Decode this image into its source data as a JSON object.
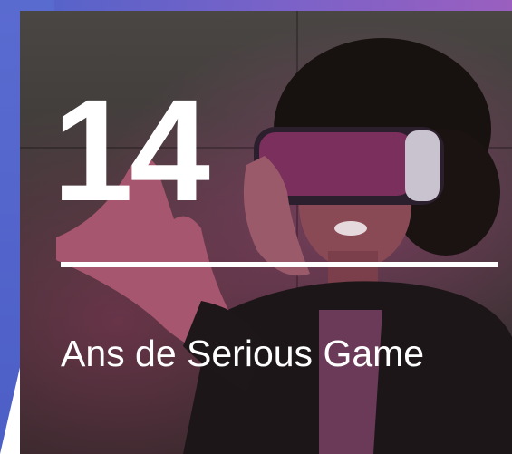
{
  "hero": {
    "number": "14",
    "subtitle": "Ans de Serious Game"
  },
  "colors": {
    "accent_blue": "#4f63c9",
    "accent_purple": "#9a5fbf",
    "text": "#ffffff"
  },
  "image": {
    "subject": "person-wearing-vr-headset-photo"
  }
}
